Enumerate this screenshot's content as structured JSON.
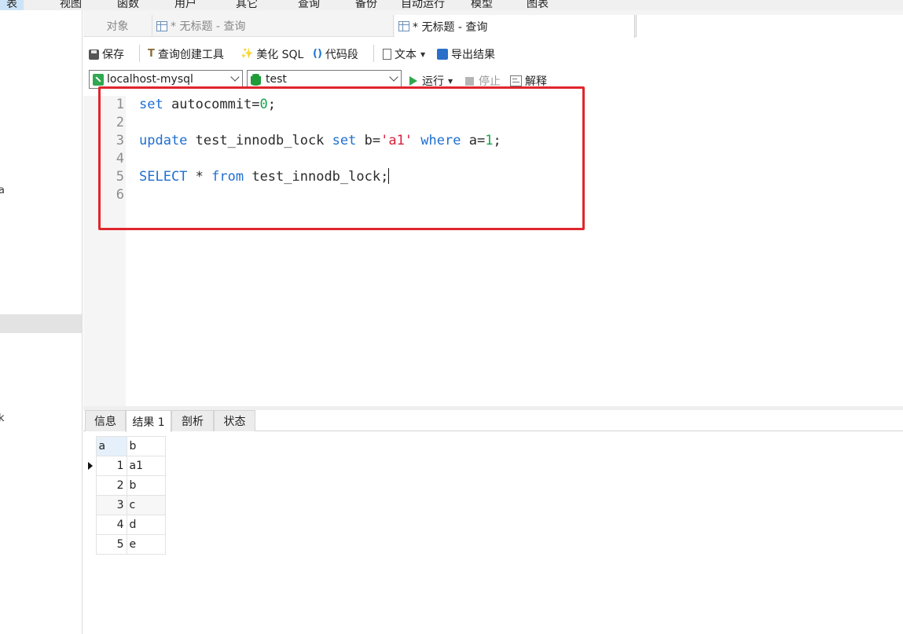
{
  "menubar": {
    "items": [
      "表",
      "视图",
      "函数",
      "用户",
      "其它",
      "查询",
      "备份",
      "自动运行",
      "模型",
      "图表"
    ]
  },
  "left_panel": {
    "fragments": [
      "a",
      "k"
    ]
  },
  "tabs": {
    "objects": "对象",
    "query1": "* 无标题 - 查询",
    "query2": "* 无标题 - 查询"
  },
  "toolbar": {
    "save": "保存",
    "query_builder": "查询创建工具",
    "beautify": "美化 SQL",
    "snippet": "代码段",
    "text": "文本",
    "export": "导出结果"
  },
  "connbar": {
    "connection": "localhost-mysql",
    "database": "test",
    "run": "运行",
    "stop": "停止",
    "explain": "解释"
  },
  "editor": {
    "line_numbers": [
      "1",
      "2",
      "3",
      "4",
      "5",
      "6"
    ]
  },
  "result_tabs": {
    "info": "信息",
    "result1": "结果 1",
    "profile": "剖析",
    "status": "状态"
  },
  "result_grid": {
    "columns": [
      "a",
      "b"
    ],
    "rows": [
      [
        "1",
        "a1"
      ],
      [
        "2",
        "b"
      ],
      [
        "3",
        "c"
      ],
      [
        "4",
        "d"
      ],
      [
        "5",
        "e"
      ]
    ]
  },
  "colors": {
    "keyword": "#1f6fd1",
    "number": "#1aa34a",
    "string": "#d81e3a",
    "highlight_box": "#e0262c"
  }
}
